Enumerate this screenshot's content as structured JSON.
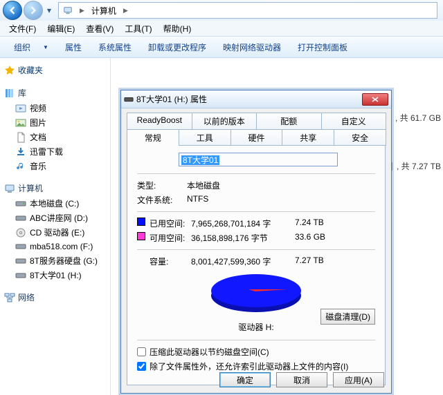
{
  "addressbar": {
    "location": "计算机"
  },
  "menubar": {
    "file": "文件(F)",
    "edit": "编辑(E)",
    "view": "查看(V)",
    "tools": "工具(T)",
    "help": "帮助(H)"
  },
  "cmdbar": {
    "organize": "组织",
    "properties": "属性",
    "sysprops": "系统属性",
    "uninstall": "卸载或更改程序",
    "mapdrive": "映射网络驱动器",
    "cpanel": "打开控制面板"
  },
  "sidebar": {
    "favorites": "收藏夹",
    "libraries": "库",
    "lib_items": {
      "videos": "视频",
      "pictures": "图片",
      "documents": "文档",
      "thunder": "迅雷下载",
      "music": "音乐"
    },
    "computer": "计算机",
    "drives": {
      "c": "本地磁盘 (C:)",
      "d": "ABC讲座网 (D:)",
      "e": "CD 驱动器 (E:)",
      "f": "mba518.com (F:)",
      "g": "8T服务器硬盘 (G:)",
      "h": "8T大学01 (H:)"
    },
    "network": "网络"
  },
  "mainpane": {
    "bar1_text": ", 共 61.7 GB",
    "bar2_text": ", 共 7.27 TB"
  },
  "dialog": {
    "title": "8T大学01 (H:) 属性",
    "tabs_row1": {
      "readyboost": "ReadyBoost",
      "prev": "以前的版本",
      "quota": "配额",
      "custom": "自定义"
    },
    "tabs_row2": {
      "general": "常规",
      "tools": "工具",
      "hardware": "硬件",
      "sharing": "共享",
      "security": "安全"
    },
    "name_value": "8T大学01",
    "type_label": "类型:",
    "type_value": "本地磁盘",
    "fs_label": "文件系统:",
    "fs_value": "NTFS",
    "used_label": "已用空间:",
    "used_bytes": "7,965,268,701,184 字",
    "used_h": "7.24 TB",
    "free_label": "可用空间:",
    "free_bytes": "36,158,898,176 字节",
    "free_h": "33.6 GB",
    "cap_label": "容量:",
    "cap_bytes": "8,001,427,599,360 字",
    "cap_h": "7.27 TB",
    "drive_label": "驱动器 H:",
    "cleanup": "磁盘清理(D)",
    "compress": "压缩此驱动器以节约磁盘空间(C)",
    "index": "除了文件属性外，还允许索引此驱动器上文件的内容(I)",
    "ok": "确定",
    "cancel": "取消",
    "apply": "应用(A)"
  },
  "chart_data": {
    "type": "pie",
    "title": "驱动器 H:",
    "series": [
      {
        "name": "已用空间",
        "value": 7965268701184,
        "human": "7.24 TB",
        "color": "#0010ff"
      },
      {
        "name": "可用空间",
        "value": 36158898176,
        "human": "33.6 GB",
        "color": "#ff3ad6"
      }
    ],
    "total": {
      "value": 8001427599360,
      "human": "7.27 TB"
    }
  }
}
